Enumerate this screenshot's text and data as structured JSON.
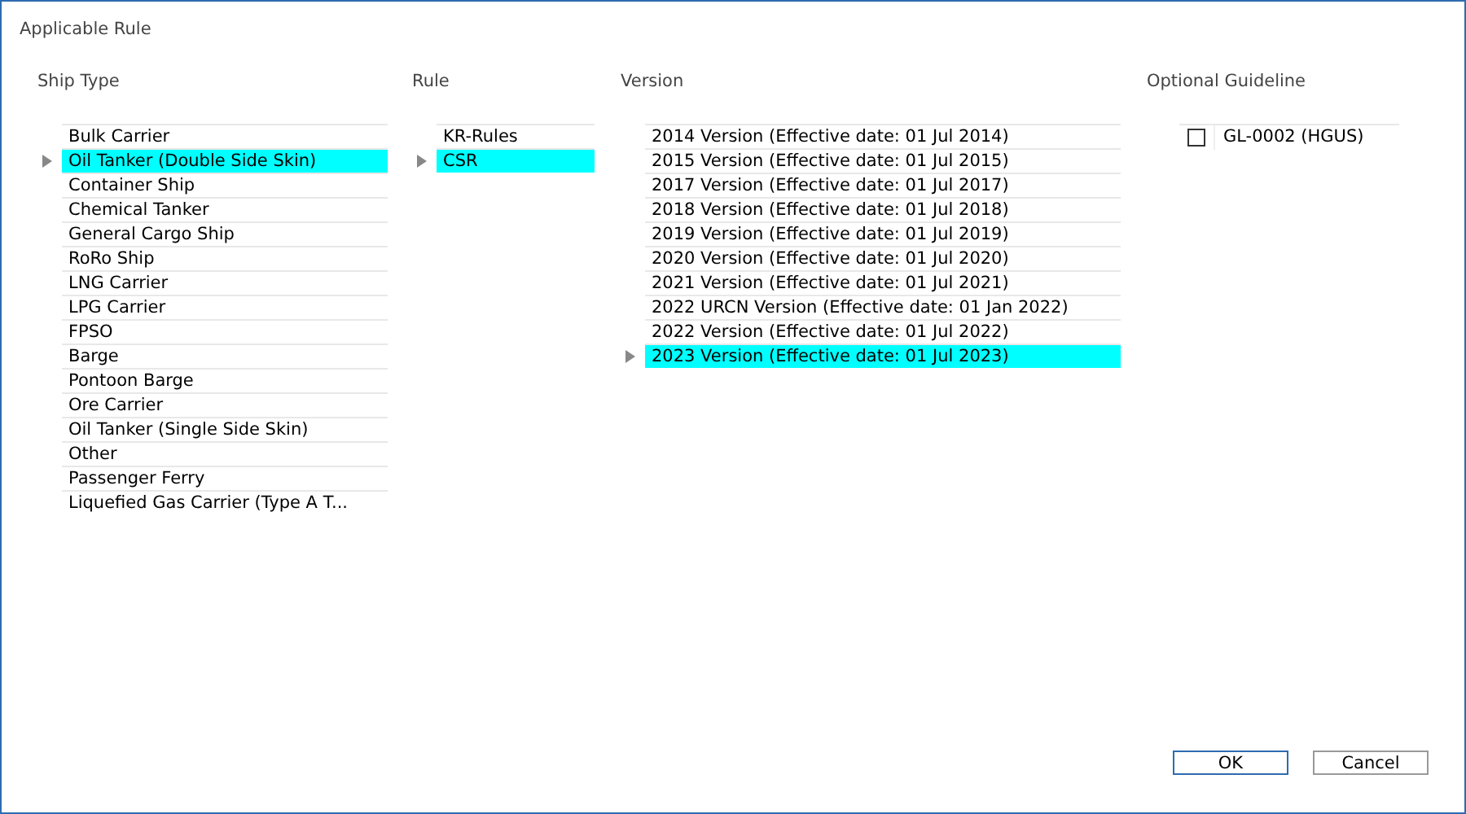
{
  "window": {
    "title": "Applicable Rule"
  },
  "ship_type": {
    "header": "Ship Type",
    "items": [
      {
        "label": "Bulk Carrier",
        "selected": false
      },
      {
        "label": "Oil Tanker (Double Side Skin)",
        "selected": true
      },
      {
        "label": "Container Ship",
        "selected": false
      },
      {
        "label": "Chemical Tanker",
        "selected": false
      },
      {
        "label": "General Cargo Ship",
        "selected": false
      },
      {
        "label": "RoRo Ship",
        "selected": false
      },
      {
        "label": "LNG Carrier",
        "selected": false
      },
      {
        "label": "LPG Carrier",
        "selected": false
      },
      {
        "label": "FPSO",
        "selected": false
      },
      {
        "label": "Barge",
        "selected": false
      },
      {
        "label": "Pontoon Barge",
        "selected": false
      },
      {
        "label": "Ore Carrier",
        "selected": false
      },
      {
        "label": "Oil Tanker (Single Side Skin)",
        "selected": false
      },
      {
        "label": "Other",
        "selected": false
      },
      {
        "label": "Passenger Ferry",
        "selected": false
      },
      {
        "label": "Liquefied Gas Carrier (Type A T...",
        "selected": false
      }
    ]
  },
  "rule": {
    "header": "Rule",
    "items": [
      {
        "label": "KR-Rules",
        "selected": false
      },
      {
        "label": "CSR",
        "selected": true
      }
    ]
  },
  "version": {
    "header": "Version",
    "items": [
      {
        "label": "2014 Version (Effective date: 01 Jul 2014)",
        "selected": false
      },
      {
        "label": "2015 Version (Effective date: 01 Jul 2015)",
        "selected": false
      },
      {
        "label": "2017 Version (Effective date: 01 Jul 2017)",
        "selected": false
      },
      {
        "label": "2018 Version (Effective date: 01 Jul 2018)",
        "selected": false
      },
      {
        "label": "2019 Version (Effective date: 01 Jul 2019)",
        "selected": false
      },
      {
        "label": "2020 Version (Effective date: 01 Jul 2020)",
        "selected": false
      },
      {
        "label": "2021 Version (Effective date: 01 Jul 2021)",
        "selected": false
      },
      {
        "label": "2022 URCN Version (Effective date: 01 Jan 2022)",
        "selected": false
      },
      {
        "label": "2022 Version (Effective date: 01 Jul 2022)",
        "selected": false
      },
      {
        "label": "2023 Version (Effective date: 01 Jul 2023)",
        "selected": true
      }
    ]
  },
  "optional_guideline": {
    "header": "Optional Guideline",
    "items": [
      {
        "label": "GL-0002 (HGUS)",
        "checked": false
      }
    ]
  },
  "buttons": [
    {
      "label": "OK",
      "default": true
    },
    {
      "label": "Cancel",
      "default": false
    }
  ]
}
